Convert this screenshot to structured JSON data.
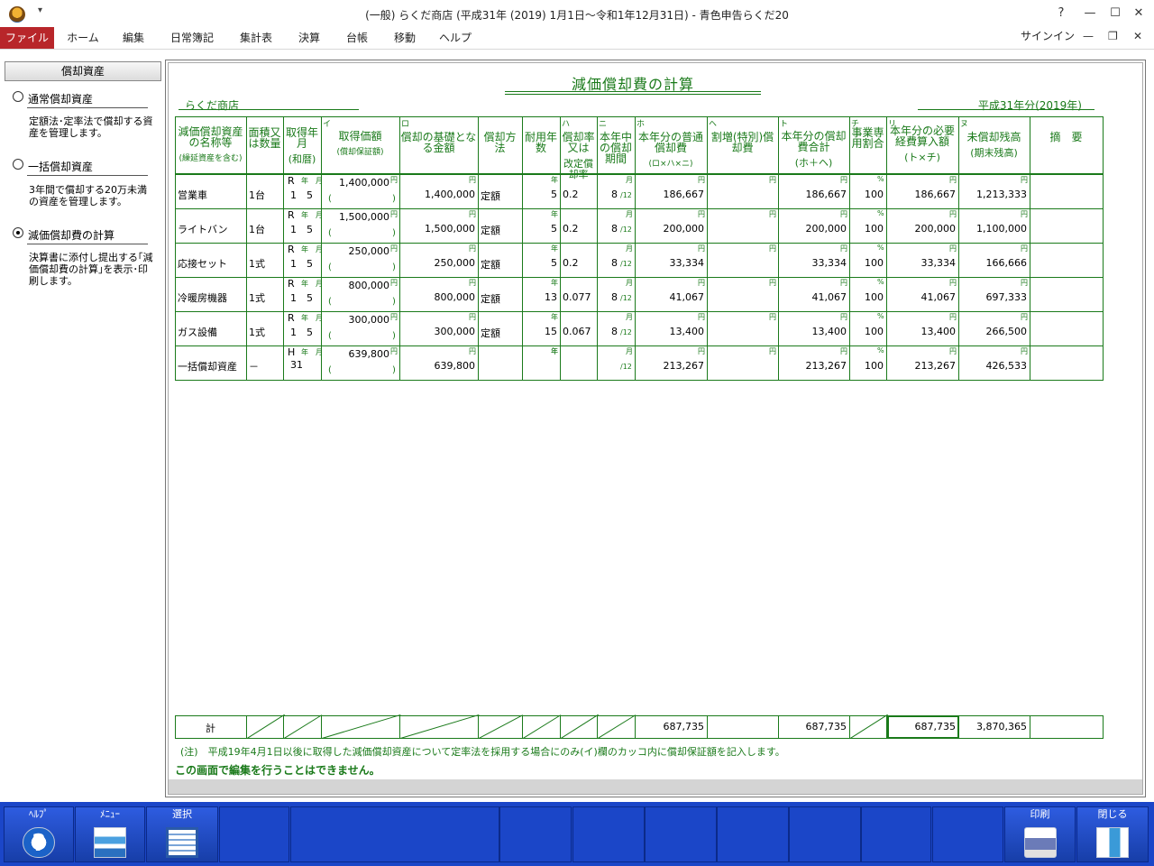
{
  "window": {
    "title": "(一般) らくだ商店 (平成31年 (2019) 1月1日～令和1年12月31日) - 青色申告らくだ20",
    "help_btn": "?",
    "quick_access": "▾"
  },
  "ribbon": {
    "tabs": [
      "ファイル",
      "ホーム",
      "編集",
      "日常簿記",
      "集計表",
      "決算",
      "台帳",
      "移動",
      "ヘルプ"
    ],
    "signin": "サインイン"
  },
  "sidebar": {
    "header": "償却資産",
    "items": [
      {
        "label": "通常償却資産",
        "desc": "定額法･定率法で償却する資産を管理します。",
        "selected": false
      },
      {
        "label": "一括償却資産",
        "desc": "3年間で償却する20万未満の資産を管理します。",
        "selected": false
      },
      {
        "label": "減価償却費の計算",
        "desc": "決算書に添付し提出する｢減価償却費の計算｣を表示･印刷します。",
        "selected": true
      }
    ]
  },
  "document": {
    "title": "減価償却費の計算",
    "shop": "らくだ商店",
    "year": "平成31年分(2019年)",
    "columns": [
      {
        "letter": "",
        "label": "減価償却資産の名称等",
        "sub": "(繰延資産を含む)"
      },
      {
        "letter": "",
        "label": "面積又は数量",
        "sub": ""
      },
      {
        "letter": "",
        "label": "取得年月",
        "sub": "(和暦)"
      },
      {
        "letter": "イ",
        "label": "取得価額",
        "sub": "(償却保証額)"
      },
      {
        "letter": "ロ",
        "label": "償却の基礎となる金額",
        "sub": ""
      },
      {
        "letter": "",
        "label": "償却方法",
        "sub": ""
      },
      {
        "letter": "",
        "label": "耐用年数",
        "sub": ""
      },
      {
        "letter": "ハ",
        "label": "償却率又は",
        "sub": "改定償却率"
      },
      {
        "letter": "ニ",
        "label": "本年中の償却期間",
        "sub": ""
      },
      {
        "letter": "ホ",
        "label": "本年分の普通償却費",
        "sub": "(ロ×ハ×ニ)"
      },
      {
        "letter": "ヘ",
        "label": "割増(特別)償却費",
        "sub": ""
      },
      {
        "letter": "ト",
        "label": "本年分の償却費合計",
        "sub": "(ホ＋ヘ)"
      },
      {
        "letter": "チ",
        "label": "事業専用割合",
        "sub": ""
      },
      {
        "letter": "リ",
        "label": "本年分の必要経費算入額",
        "sub": "(ト×チ)"
      },
      {
        "letter": "ヌ",
        "label": "未償却残高",
        "sub": "(期末残高)"
      },
      {
        "letter": "",
        "label": "摘　要",
        "sub": ""
      }
    ],
    "units": {
      "yen": "円",
      "year": "年",
      "month": "月",
      "pct": "%",
      "nen_tsuki": "年　月",
      "per12": "/12",
      "paren_open": "(",
      "paren_close": ")"
    },
    "rows": [
      {
        "name": "営業車",
        "qty": "1台",
        "era": "R",
        "date": "1　5",
        "acq": "1,400,000",
        "base": "1,400,000",
        "method": "定額",
        "life": "5",
        "rate": "0.2",
        "months": "8",
        "normal": "186,667",
        "extra": "",
        "total": "186,667",
        "ratio": "100",
        "expense": "186,667",
        "remain": "1,213,333"
      },
      {
        "name": "ライトバン",
        "qty": "1台",
        "era": "R",
        "date": "1　5",
        "acq": "1,500,000",
        "base": "1,500,000",
        "method": "定額",
        "life": "5",
        "rate": "0.2",
        "months": "8",
        "normal": "200,000",
        "extra": "",
        "total": "200,000",
        "ratio": "100",
        "expense": "200,000",
        "remain": "1,100,000"
      },
      {
        "name": "応接セット",
        "qty": "1式",
        "era": "R",
        "date": "1　5",
        "acq": "250,000",
        "base": "250,000",
        "method": "定額",
        "life": "5",
        "rate": "0.2",
        "months": "8",
        "normal": "33,334",
        "extra": "",
        "total": "33,334",
        "ratio": "100",
        "expense": "33,334",
        "remain": "166,666"
      },
      {
        "name": "冷暖房機器",
        "qty": "1式",
        "era": "R",
        "date": "1　5",
        "acq": "800,000",
        "base": "800,000",
        "method": "定額",
        "life": "13",
        "rate": "0.077",
        "months": "8",
        "normal": "41,067",
        "extra": "",
        "total": "41,067",
        "ratio": "100",
        "expense": "41,067",
        "remain": "697,333"
      },
      {
        "name": "ガス設備",
        "qty": "1式",
        "era": "R",
        "date": "1　5",
        "acq": "300,000",
        "base": "300,000",
        "method": "定額",
        "life": "15",
        "rate": "0.067",
        "months": "8",
        "normal": "13,400",
        "extra": "",
        "total": "13,400",
        "ratio": "100",
        "expense": "13,400",
        "remain": "266,500"
      },
      {
        "name": "一括償却資産",
        "qty": "－",
        "era": "H",
        "date": "31",
        "acq": "639,800",
        "base": "639,800",
        "method": "",
        "life": "",
        "rate": "",
        "months": "",
        "normal": "213,267",
        "extra": "",
        "total": "213,267",
        "ratio": "100",
        "expense": "213,267",
        "remain": "426,533"
      }
    ],
    "totals": {
      "label": "計",
      "normal": "687,735",
      "total": "687,735",
      "expense": "687,735",
      "remain": "3,870,365"
    },
    "note": "(注)　平成19年4月1日以後に取得した減価償却資産について定率法を採用する場合にのみ(イ)欄のカッコ内に償却保証額を記入します。",
    "warning": "この画面で編集を行うことはできません。"
  },
  "fkeys": [
    {
      "label": "ﾍﾙﾌﾟ",
      "icon": "help-icon"
    },
    {
      "label": "ﾒﾆｭｰ",
      "icon": "menu-icon"
    },
    {
      "label": "選択",
      "icon": "select-icon"
    },
    {
      "label": "",
      "icon": ""
    },
    {
      "label": "",
      "icon": ""
    },
    {
      "label": "",
      "icon": ""
    },
    {
      "label": "",
      "icon": ""
    },
    {
      "label": "",
      "icon": ""
    },
    {
      "label": "",
      "icon": ""
    },
    {
      "label": "",
      "icon": ""
    },
    {
      "label": "",
      "icon": ""
    },
    {
      "label": "",
      "icon": ""
    },
    {
      "label": "",
      "icon": ""
    },
    {
      "label": "印刷",
      "icon": "printer-icon"
    },
    {
      "label": "閉じる",
      "icon": "exit-door-icon"
    }
  ],
  "colors": {
    "accent_green": "#1a7a1a",
    "file_tab": "#b8262a",
    "fkey_bar": "#1b46c8"
  }
}
